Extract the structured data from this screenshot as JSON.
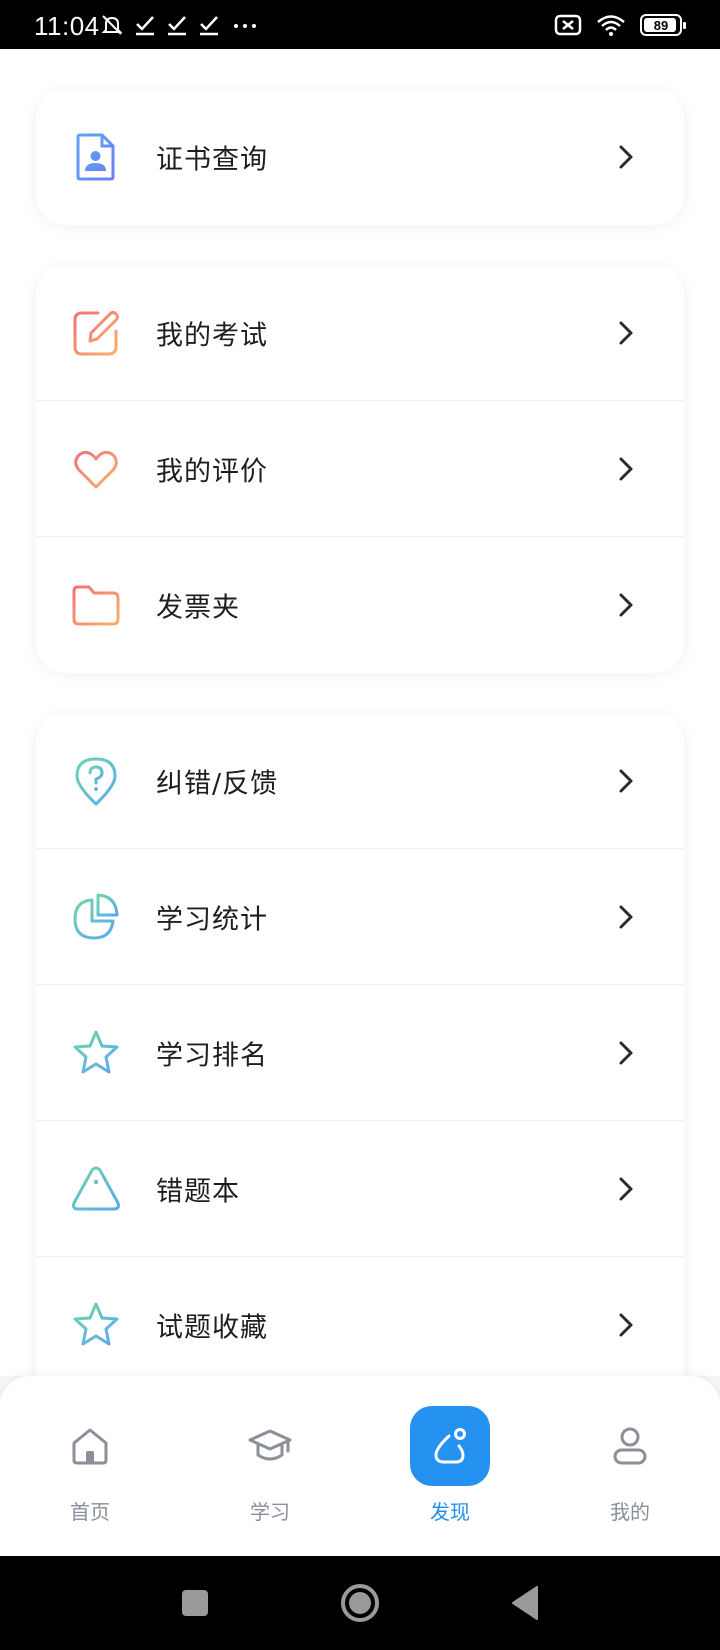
{
  "status_bar": {
    "time": "11:04",
    "battery": "89",
    "icons": [
      "mute-icon",
      "check-icon",
      "check-icon",
      "check-icon",
      "more-dots-icon",
      "sim-x-icon",
      "wifi-icon",
      "battery-icon"
    ]
  },
  "cards": [
    {
      "items": [
        {
          "label": "证书查询",
          "icon": "certificate-icon"
        }
      ]
    },
    {
      "items": [
        {
          "label": "我的考试",
          "icon": "edit-icon"
        },
        {
          "label": "我的评价",
          "icon": "heart-icon"
        },
        {
          "label": "发票夹",
          "icon": "folder-icon"
        }
      ]
    },
    {
      "items": [
        {
          "label": "纠错/反馈",
          "icon": "question-pin-icon"
        },
        {
          "label": "学习统计",
          "icon": "pie-chart-icon"
        },
        {
          "label": "学习排名",
          "icon": "star-icon"
        },
        {
          "label": "错题本",
          "icon": "warning-icon"
        },
        {
          "label": "试题收藏",
          "icon": "star-icon"
        }
      ]
    }
  ],
  "tab_bar": {
    "tabs": [
      {
        "label": "首页",
        "icon": "home-icon",
        "active": false
      },
      {
        "label": "学习",
        "icon": "graduation-cap-icon",
        "active": false
      },
      {
        "label": "发现",
        "icon": "discover-icon",
        "active": true
      },
      {
        "label": "我的",
        "icon": "user-icon",
        "active": false
      }
    ]
  },
  "colors": {
    "accent": "#2591f1",
    "active_label": "#1f8ff0",
    "inactive_label": "#8a8f99"
  }
}
